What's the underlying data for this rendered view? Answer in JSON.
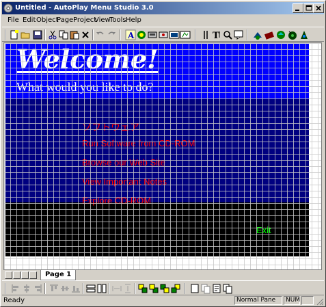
{
  "window": {
    "title": "Untitled - AutoPlay Menu Studio 3.0"
  },
  "menubar": {
    "items": [
      "File",
      "Edit",
      "Object",
      "Page",
      "Project",
      "View",
      "Tools",
      "Help"
    ]
  },
  "toolbar": {
    "icons": [
      "new-icon",
      "open-icon",
      "save-icon",
      "cut-icon",
      "copy-icon",
      "paste-icon",
      "delete-icon",
      "undo-icon",
      "redo-icon",
      "text-object-icon",
      "image-object-icon",
      "button-object-icon",
      "hotspot-object-icon",
      "video-object-icon",
      "flash-object-icon",
      "properties-icon",
      "text-tool-icon",
      "zoom-icon",
      "preview-icon",
      "run-icon",
      "build-icon",
      "publish-icon",
      "cd-icon",
      "help-icon"
    ]
  },
  "page": {
    "title": "Welcome!",
    "subtitle": "What would you like to do?",
    "menu_items": [
      "ソフトウェア",
      "Run Software from CD-ROM",
      "Browse our Web Site",
      "View Important Notes",
      "Explore CD-ROM"
    ],
    "exit_label": "Exit",
    "colors": {
      "band1": "#0000ff",
      "band2": "#000080",
      "band3": "#000000",
      "menu_text": "#ff0000",
      "exit_text": "#00ff00"
    }
  },
  "tabs": {
    "active": "Page 1"
  },
  "statusbar": {
    "text": "Ready",
    "pane1": "Normal Pane",
    "pane2": "NUM"
  }
}
